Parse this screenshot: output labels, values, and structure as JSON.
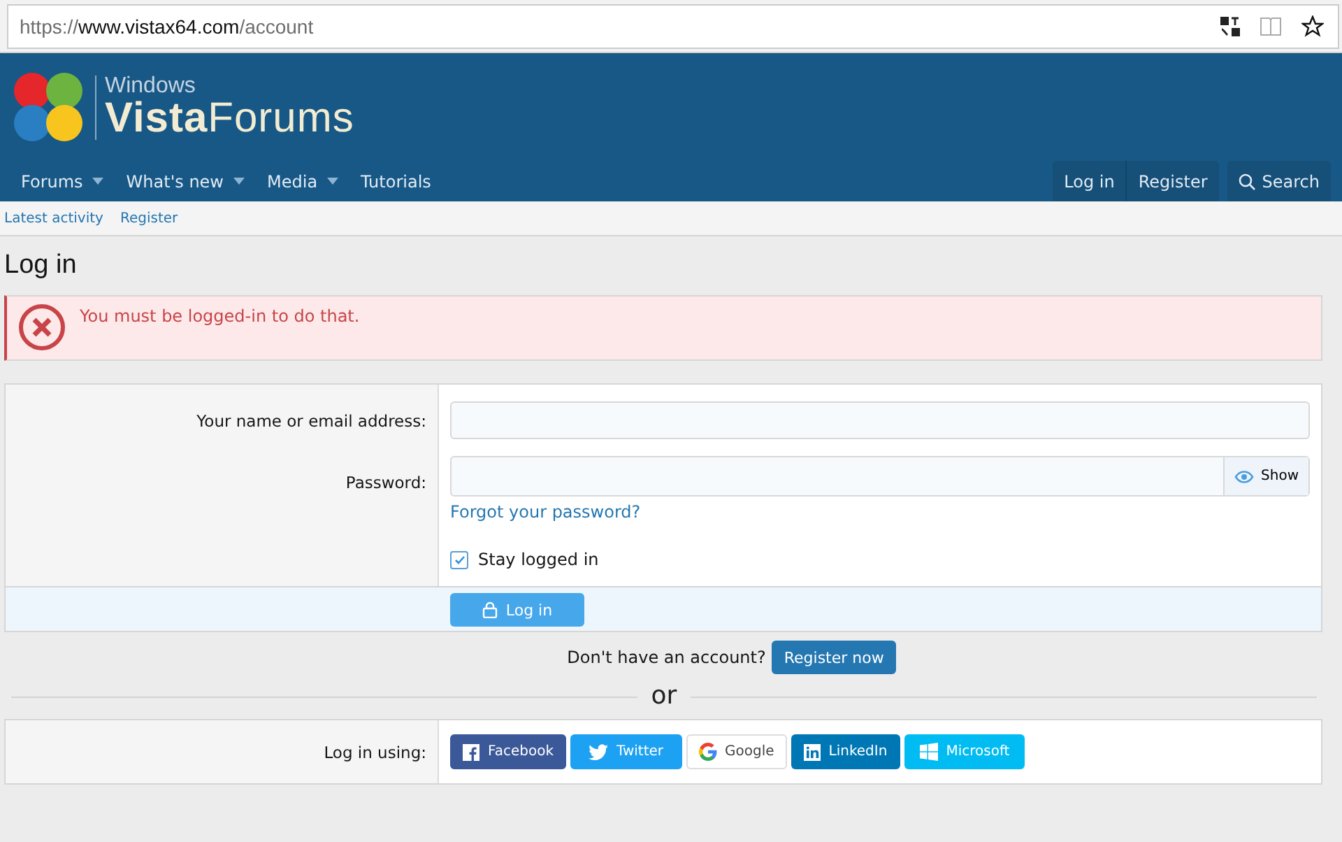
{
  "browser": {
    "url_prefix": "https://",
    "url_host": "www.vistax64.com",
    "url_path": "/account"
  },
  "logo": {
    "top": "Windows",
    "bold": "Vista",
    "light": "Forums"
  },
  "nav": [
    {
      "label": "Forums",
      "has_menu": true
    },
    {
      "label": "What's new",
      "has_menu": true
    },
    {
      "label": "Media",
      "has_menu": true
    },
    {
      "label": "Tutorials",
      "has_menu": false
    }
  ],
  "account_nav": [
    "Log in",
    "Register"
  ],
  "search_button": "Search",
  "subnav": [
    "Latest activity",
    "Register"
  ],
  "page_title": "Log in",
  "error_message": "You must be logged-in to do that.",
  "form": {
    "name_label": "Your name or email address:",
    "password_label": "Password:",
    "show_button": "Show",
    "forgot_link": "Forgot your password?",
    "stay_logged_in": {
      "label": "Stay logged in",
      "checked": true
    },
    "submit": "Log in"
  },
  "register_prompt": "Don't have an account?",
  "register_button": "Register now",
  "divider_text": "or",
  "social": {
    "label": "Log in using:",
    "providers": [
      {
        "kind": "facebook",
        "label": "Facebook"
      },
      {
        "kind": "twitter",
        "label": "Twitter"
      },
      {
        "kind": "google",
        "label": "Google"
      },
      {
        "kind": "linkedin",
        "label": "LinkedIn"
      },
      {
        "kind": "microsoft",
        "label": "Microsoft"
      }
    ]
  }
}
